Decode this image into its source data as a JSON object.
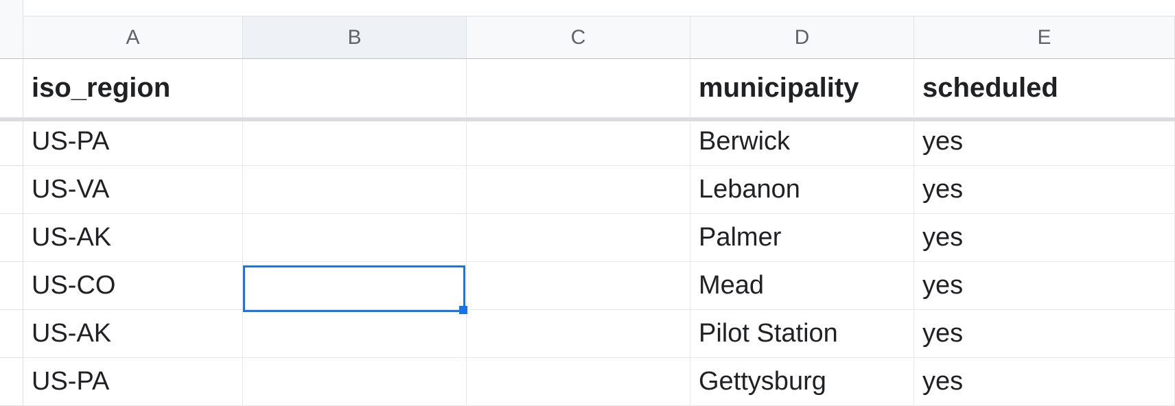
{
  "columns": [
    "A",
    "B",
    "C",
    "D",
    "E"
  ],
  "selected_column_index": 1,
  "header_row": {
    "A": "iso_region",
    "B": "",
    "C": "",
    "D": "municipality",
    "E": "scheduled"
  },
  "rows": [
    {
      "A": "US-PA",
      "B": "",
      "C": "",
      "D": "Berwick",
      "E": "yes"
    },
    {
      "A": "US-VA",
      "B": "",
      "C": "",
      "D": "Lebanon",
      "E": "yes"
    },
    {
      "A": "US-AK",
      "B": "",
      "C": "",
      "D": "Palmer",
      "E": "yes"
    },
    {
      "A": "US-CO",
      "B": "",
      "C": "",
      "D": "Mead",
      "E": "yes"
    },
    {
      "A": "US-AK",
      "B": "",
      "C": "",
      "D": "Pilot Station",
      "E": "yes"
    },
    {
      "A": "US-PA",
      "B": "",
      "C": "",
      "D": "Gettysburg",
      "E": "yes"
    }
  ],
  "selection": {
    "col": "B",
    "row_index": 3
  },
  "chart_data": {
    "type": "table",
    "columns": [
      "iso_region",
      "",
      "",
      "municipality",
      "scheduled"
    ],
    "data": [
      [
        "US-PA",
        "",
        "",
        "Berwick",
        "yes"
      ],
      [
        "US-VA",
        "",
        "",
        "Lebanon",
        "yes"
      ],
      [
        "US-AK",
        "",
        "",
        "Palmer",
        "yes"
      ],
      [
        "US-CO",
        "",
        "",
        "Mead",
        "yes"
      ],
      [
        "US-AK",
        "",
        "",
        "Pilot Station",
        "yes"
      ],
      [
        "US-PA",
        "",
        "",
        "Gettysburg",
        "yes"
      ]
    ]
  }
}
